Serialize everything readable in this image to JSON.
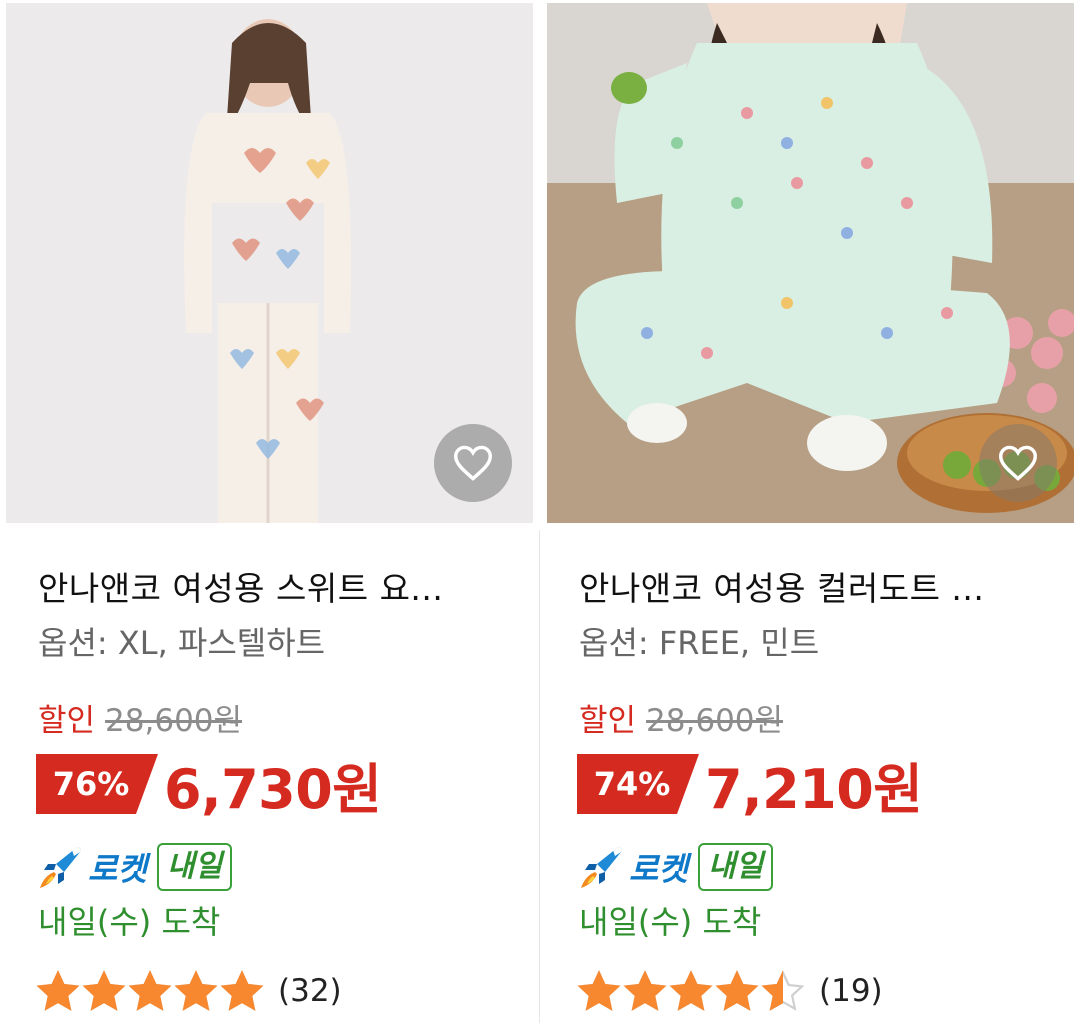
{
  "products": [
    {
      "title": "안나앤코 여성용 스위트 요...",
      "option": "옵션: XL, 파스텔하트",
      "discount_label": "할인",
      "original_price": "28,600원",
      "discount_percent": "76%",
      "price": "6,730원",
      "rocket_label": "로켓",
      "tomorrow_badge": "내일",
      "arrival": "내일(수) 도착",
      "rating": 5,
      "review_count": "(32)"
    },
    {
      "title": "안나앤코 여성용 컬러도트 ...",
      "option": "옵션: FREE, 민트",
      "discount_label": "할인",
      "original_price": "28,600원",
      "discount_percent": "74%",
      "price": "7,210원",
      "rocket_label": "로켓",
      "tomorrow_badge": "내일",
      "arrival": "내일(수) 도착",
      "rating": 4.5,
      "review_count": "(19)"
    }
  ],
  "colors": {
    "discount_red": "#d52a20",
    "rocket_blue": "#0f79c9",
    "arrival_green": "#2f8f2f",
    "star_orange": "#f7882f"
  },
  "icons": {
    "wishlist": "heart-outline-icon",
    "rocket": "rocket-icon",
    "rating": "star-icon"
  }
}
